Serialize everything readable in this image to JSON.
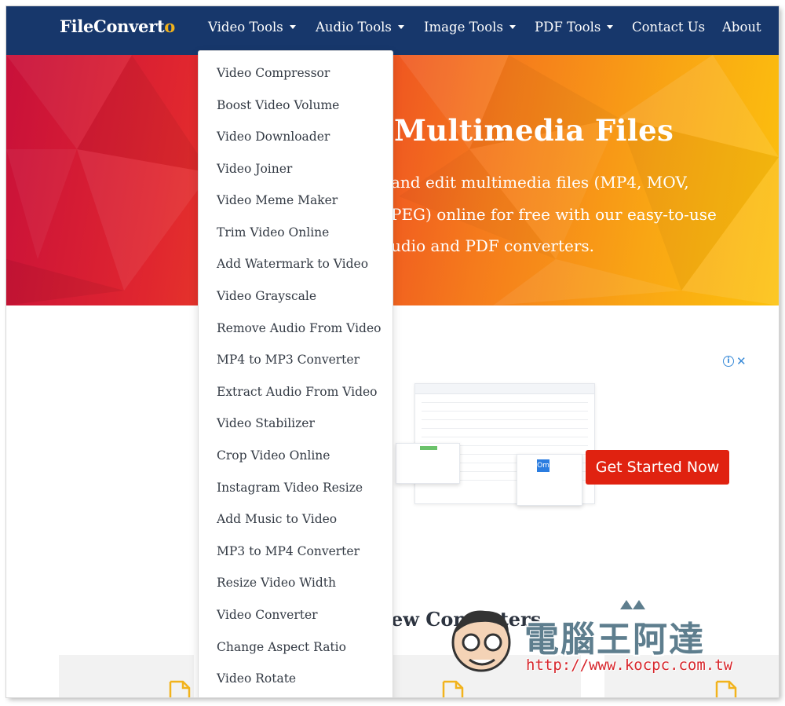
{
  "brand": {
    "name_main": "FileConvert",
    "name_accent": "o"
  },
  "nav": {
    "items": [
      {
        "label": "Video Tools",
        "dropdown": true
      },
      {
        "label": "Audio Tools",
        "dropdown": true
      },
      {
        "label": "Image Tools",
        "dropdown": true
      },
      {
        "label": "PDF Tools",
        "dropdown": true
      },
      {
        "label": "Contact Us",
        "dropdown": false
      },
      {
        "label": "About",
        "dropdown": false
      }
    ]
  },
  "video_tools_menu": {
    "items": [
      "Video Compressor",
      "Boost Video Volume",
      "Video Downloader",
      "Video Joiner",
      "Video Meme Maker",
      "Trim Video Online",
      "Add Watermark to Video",
      "Video Grayscale",
      "Remove Audio From Video",
      "MP4 to MP3 Converter",
      "Extract Audio From Video",
      "Video Stabilizer",
      "Crop Video Online",
      "Instagram Video Resize",
      "Add Music to Video",
      "MP3 to MP4 Converter",
      "Resize Video Width",
      "Video Converter",
      "Change Aspect Ratio",
      "Video Rotate"
    ]
  },
  "hero": {
    "title_visible": "Multimedia Files",
    "lines": [
      "and edit multimedia files (MP4, MOV,",
      "PEG) online for free with our easy-to-use",
      "udio and PDF converters."
    ]
  },
  "ad": {
    "info_glyph": "i",
    "close_glyph": "✕",
    "cta_label": "Get Started Now",
    "mock_logo": "Om"
  },
  "section": {
    "title_visible": "ew Converters"
  },
  "watermark": {
    "text": "電腦王阿達",
    "url": "http://www.kocpc.com.tw"
  },
  "colors": {
    "nav_bg": "#17376b",
    "brand_accent": "#f1b21c",
    "cta_bg": "#e02210",
    "ad_icon": "#3a8bd8",
    "file_icon": "#f2b31c"
  }
}
